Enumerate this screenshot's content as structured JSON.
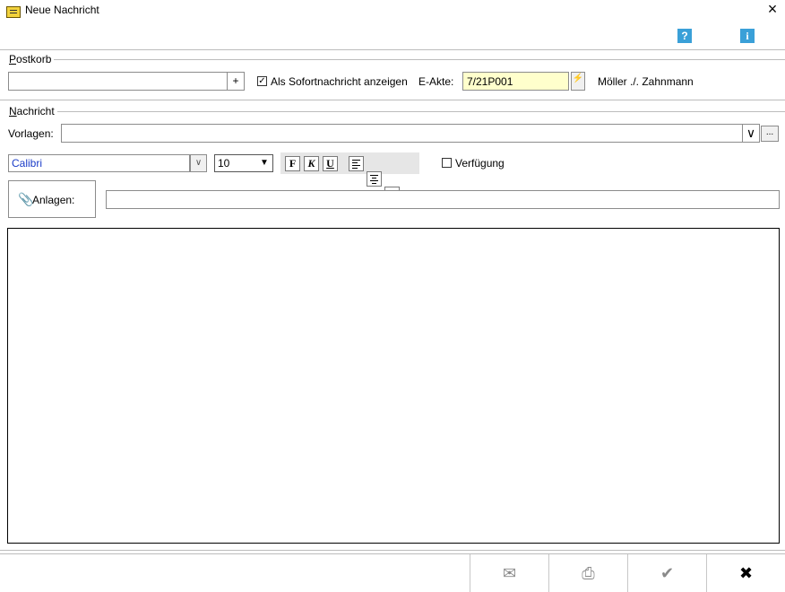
{
  "window": {
    "title": "Neue Nachricht",
    "close_glyph": "×"
  },
  "header": {
    "help_glyph": "?",
    "info_glyph": "i"
  },
  "postkorb": {
    "group_label_first": "P",
    "group_label_rest": "ostkorb",
    "input_value": "",
    "add_label": "+",
    "sofort_checked": true,
    "sofort_label": "Als Sofortnachricht anzeigen",
    "eakte_label": "E-Akte:",
    "eakte_value": "7/21P001",
    "eakte_names": "Möller ./. Zahnmann"
  },
  "nachricht": {
    "group_label_first": "N",
    "group_label_rest": "achricht",
    "vorlagen_label": "Vorlagen:",
    "vorlagen_value": "",
    "more_label": "...",
    "font_value": "Calibri",
    "size_value": "10",
    "bold_label": "F",
    "italic_label": "K",
    "underline_label": "U",
    "verfuegung_checked": false,
    "verfuegung_label": "Verfügung",
    "anlagen_label": "Anlagen:",
    "anlagen_value": "",
    "body_text": ""
  },
  "footer": {
    "send_glyph": "✉",
    "print_glyph": "⎙",
    "ok_glyph": "✔",
    "cancel_glyph": "✖"
  },
  "colors": {
    "eakte_bg": "#ffffcc",
    "font_color": "#1a3cc8",
    "help_blue": "#3aa0d8"
  }
}
